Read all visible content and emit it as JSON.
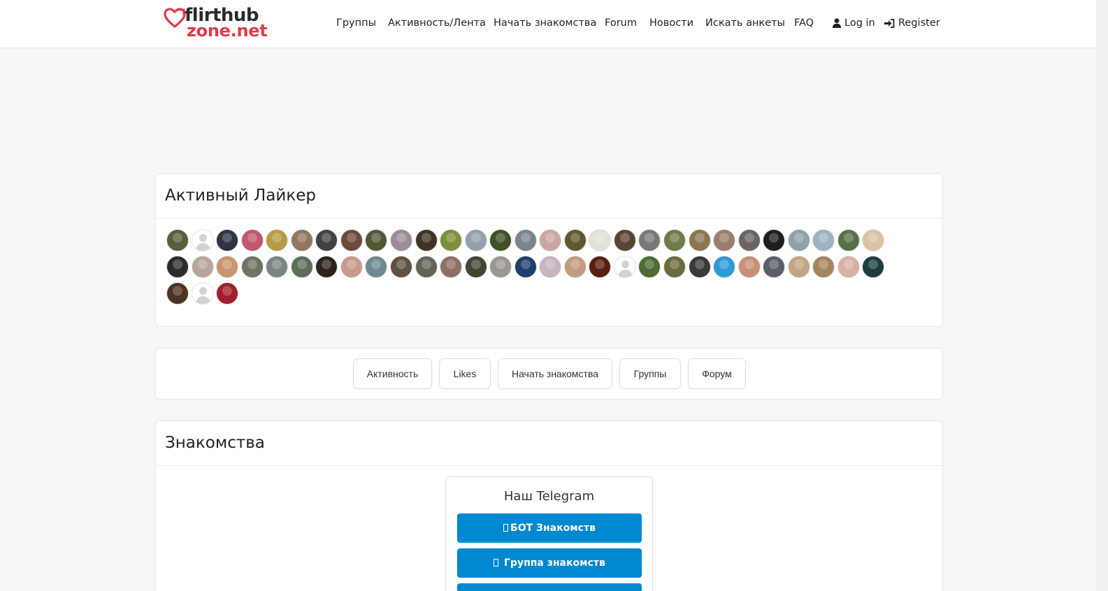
{
  "site": {
    "logo_line1": "flirthub",
    "logo_line2": "zone.net"
  },
  "nav": {
    "items": [
      "Группы",
      "Активность/Лента",
      "Начать знакомства",
      "Forum",
      "Новости",
      "Искать анкеты",
      "FAQ"
    ],
    "login": "Log in",
    "register": "Register"
  },
  "liker": {
    "title": "Активный Лайкер",
    "avatar_colors": [
      "#5b5e3a",
      "placeholder",
      "#2e3440",
      "#c2566e",
      "#b89a45",
      "#8f7760",
      "#3d4344",
      "#6d4b3a",
      "#4e5a36",
      "#9a8f99",
      "#3f3424",
      "#7d8e3c",
      "#92a1ab",
      "#415027",
      "#7a858c",
      "#c9a6a1",
      "#5f5a2e",
      "#e4e0da",
      "#5a4434",
      "#777b76",
      "#6e7d46",
      "#8c7651",
      "#9c7d6d",
      "#6b6460",
      "#1e1e22",
      "#8ea2a8",
      "#9db3c0",
      "#587047",
      "#d8c3a3",
      "#2d2b29",
      "#b7a49b",
      "#c9956e",
      "#6d7560",
      "#7b8484",
      "#5c6e56",
      "#2b241d",
      "#c89a8a",
      "#6d8a94",
      "#5f5245",
      "#646356",
      "#8d7062",
      "#3f4531",
      "#9b9892",
      "#1e3e6f",
      "#c6b5c0",
      "#c29b83",
      "#5a1e11",
      "placeholder",
      "#4d6b32",
      "#6b6b3f",
      "#3a3a3a",
      "#2f9ad6",
      "#c78f74",
      "#5a5f66",
      "#c2a583",
      "#a6845f",
      "#d7b1a5",
      "#1d3d3d",
      "#4e3222",
      "placeholder",
      "#a11e2c"
    ]
  },
  "tabs": {
    "items": [
      "Активность",
      "Likes",
      "Начать знакомства",
      "Группы",
      "Форум"
    ]
  },
  "dating": {
    "title": "Знакомства",
    "telegram": {
      "title": "Наш Telegram",
      "bot_label": "БОТ Знакомств",
      "group_label": "Группа знакомств"
    }
  }
}
